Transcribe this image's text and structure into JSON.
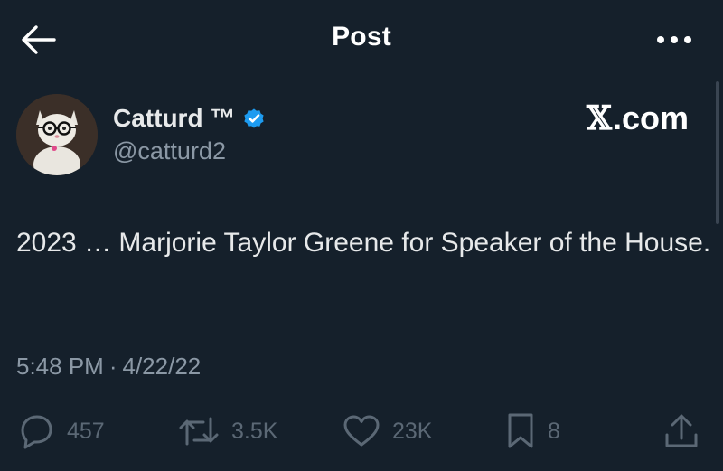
{
  "header": {
    "title": "Post",
    "back_icon": "arrow-left-icon",
    "more_icon": "more-horizontal-icon"
  },
  "author": {
    "display_name": "Catturd ™",
    "handle": "@catturd2",
    "verified": true,
    "verified_color": "#1d9bf0",
    "avatar_desc": "cat-with-glasses-avatar"
  },
  "watermark": {
    "x_symbol": "𝕏",
    "suffix": ".com"
  },
  "post": {
    "text": "2023 … Marjorie Taylor Greene for Speaker of the House.",
    "time": "5:48 PM",
    "separator": "·",
    "date": "4/22/22"
  },
  "actions": {
    "replies": {
      "icon": "reply-icon",
      "count": "457"
    },
    "reposts": {
      "icon": "repost-icon",
      "count": "3.5K"
    },
    "likes": {
      "icon": "heart-icon",
      "count": "23K"
    },
    "bookmarks": {
      "icon": "bookmark-icon",
      "count": "8"
    },
    "share": {
      "icon": "share-icon"
    }
  },
  "colors": {
    "background": "#15202b",
    "text_primary": "#e7e9ea",
    "text_secondary": "#8b98a5",
    "action_muted": "#5b6875",
    "accent": "#1d9bf0"
  }
}
